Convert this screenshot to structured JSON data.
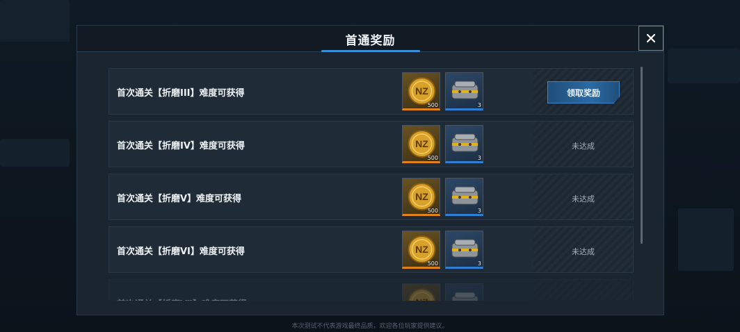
{
  "modal": {
    "title": "首通奖励",
    "close_glyph": "✕"
  },
  "rows": [
    {
      "text": "首次通关【折磨III】难度可获得",
      "coin_count": "500",
      "crate_count": "3",
      "status": "领取奖励",
      "claimable": true
    },
    {
      "text": "首次通关【折磨IV】难度可获得",
      "coin_count": "500",
      "crate_count": "3",
      "status": "未达成",
      "claimable": false
    },
    {
      "text": "首次通关【折磨V】难度可获得",
      "coin_count": "500",
      "crate_count": "3",
      "status": "未达成",
      "claimable": false
    },
    {
      "text": "首次通关【折磨VI】难度可获得",
      "coin_count": "500",
      "crate_count": "3",
      "status": "未达成",
      "claimable": false
    },
    {
      "text": "首次通关【折磨Ⅶ】难度可获得",
      "coin_count": "",
      "crate_count": "",
      "status": "",
      "claimable": false
    }
  ],
  "footer": {
    "text": "本次测试不代表游戏最终品质，欢迎各位玩家提供建议。"
  },
  "icons": {
    "coin": "nz-coin-icon",
    "crate": "supply-crate-icon",
    "close": "close-icon"
  },
  "colors": {
    "accent": "#3b8fd6",
    "coin_bar": "#e0821d",
    "crate_bar": "#2f7fd4"
  }
}
